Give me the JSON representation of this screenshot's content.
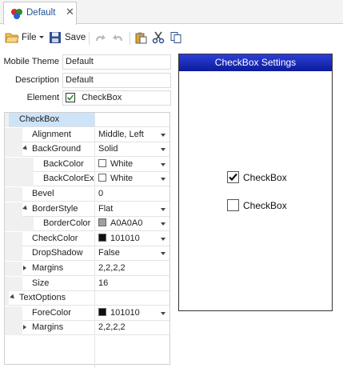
{
  "tab": {
    "label": "Default",
    "close": "✕"
  },
  "toolbar": {
    "file_label": "File",
    "save_label": "Save"
  },
  "form": {
    "mobile_theme_label": "Mobile Theme",
    "mobile_theme_value": "Default",
    "description_label": "Description",
    "description_value": "Default",
    "element_label": "Element",
    "element_value": "CheckBox",
    "element_checked": true
  },
  "property_grid": {
    "rows": [
      {
        "name": "CheckBox",
        "value": "",
        "level": 0,
        "expander": "open",
        "category": true,
        "selected": true
      },
      {
        "name": "Alignment",
        "value": "Middle, Left",
        "level": 1,
        "dropdown": true
      },
      {
        "name": "BackGround",
        "value": "Solid",
        "level": 1,
        "expander": "open",
        "dropdown": true
      },
      {
        "name": "BackColor",
        "value": "White",
        "level": 2,
        "swatch": "#ffffff",
        "dropdown": true
      },
      {
        "name": "BackColorEx",
        "value": "White",
        "level": 2,
        "swatch": "#ffffff",
        "dropdown": true
      },
      {
        "name": "Bevel",
        "value": "0",
        "level": 1
      },
      {
        "name": "BorderStyle",
        "value": "Flat",
        "level": 1,
        "expander": "open",
        "dropdown": true
      },
      {
        "name": "BorderColor",
        "value": "A0A0A0",
        "level": 2,
        "swatch": "#a0a0a0",
        "dropdown": true
      },
      {
        "name": "CheckColor",
        "value": "101010",
        "level": 1,
        "swatch": "#101010",
        "dropdown": true
      },
      {
        "name": "DropShadow",
        "value": "False",
        "level": 1,
        "dropdown": true
      },
      {
        "name": "Margins",
        "value": "2,2,2,2",
        "level": 1,
        "expander": "closed"
      },
      {
        "name": "Size",
        "value": "16",
        "level": 1
      },
      {
        "name": "TextOptions",
        "value": "",
        "level": 0,
        "expander": "open",
        "category": true
      },
      {
        "name": "ForeColor",
        "value": "101010",
        "level": 1,
        "swatch": "#101010",
        "dropdown": true
      },
      {
        "name": "Margins",
        "value": "2,2,2,2",
        "level": 1,
        "expander": "closed"
      }
    ]
  },
  "preview": {
    "title": "CheckBox Settings",
    "items": [
      {
        "label": "CheckBox",
        "checked": true
      },
      {
        "label": "CheckBox",
        "checked": false
      }
    ]
  },
  "colors": {
    "title_bar": "#1a2bc0",
    "selection": "#cde3f8",
    "tab_text": "#1f4f8f"
  }
}
